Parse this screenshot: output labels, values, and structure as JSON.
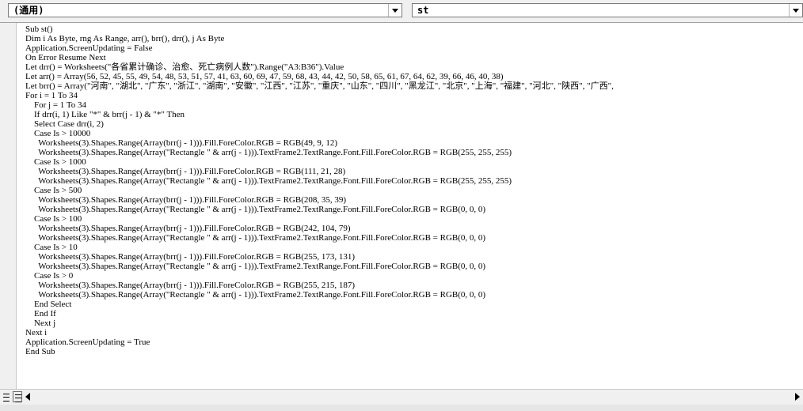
{
  "object_combo": {
    "value": "(通用)"
  },
  "procedure_combo": {
    "value": "st"
  },
  "code_lines": [
    "Sub st()",
    "Dim i As Byte, rng As Range, arr(), brr(), drr(), j As Byte",
    "Application.ScreenUpdating = False",
    "On Error Resume Next",
    "Let drr() = Worksheets(\"各省累计确诊、治愈、死亡病例人数\").Range(\"A3:B36\").Value",
    "Let arr() = Array(56, 52, 45, 55, 49, 54, 48, 53, 51, 57, 41, 63, 60, 69, 47, 59, 68, 43, 44, 42, 50, 58, 65, 61, 67, 64, 62, 39, 66, 46, 40, 38)",
    "Let brr() = Array(\"河南\", \"湖北\", \"广东\", \"浙江\", \"湖南\", \"安徽\", \"江西\", \"江苏\", \"重庆\", \"山东\", \"四川\", \"黑龙江\", \"北京\", \"上海\", \"福建\", \"河北\", \"陕西\", \"广西\",",
    "For i = 1 To 34",
    "    For j = 1 To 34",
    "    If drr(i, 1) Like \"*\" & brr(j - 1) & \"*\" Then",
    "    Select Case drr(i, 2)",
    "    Case Is > 10000",
    "      Worksheets(3).Shapes.Range(Array(brr(j - 1))).Fill.ForeColor.RGB = RGB(49, 9, 12)",
    "      Worksheets(3).Shapes.Range(Array(\"Rectangle \" & arr(j - 1))).TextFrame2.TextRange.Font.Fill.ForeColor.RGB = RGB(255, 255, 255)",
    "    Case Is > 1000",
    "      Worksheets(3).Shapes.Range(Array(brr(j - 1))).Fill.ForeColor.RGB = RGB(111, 21, 28)",
    "      Worksheets(3).Shapes.Range(Array(\"Rectangle \" & arr(j - 1))).TextFrame2.TextRange.Font.Fill.ForeColor.RGB = RGB(255, 255, 255)",
    "    Case Is > 500",
    "      Worksheets(3).Shapes.Range(Array(brr(j - 1))).Fill.ForeColor.RGB = RGB(208, 35, 39)",
    "      Worksheets(3).Shapes.Range(Array(\"Rectangle \" & arr(j - 1))).TextFrame2.TextRange.Font.Fill.ForeColor.RGB = RGB(0, 0, 0)",
    "    Case Is > 100",
    "      Worksheets(3).Shapes.Range(Array(brr(j - 1))).Fill.ForeColor.RGB = RGB(242, 104, 79)",
    "      Worksheets(3).Shapes.Range(Array(\"Rectangle \" & arr(j - 1))).TextFrame2.TextRange.Font.Fill.ForeColor.RGB = RGB(0, 0, 0)",
    "    Case Is > 10",
    "      Worksheets(3).Shapes.Range(Array(brr(j - 1))).Fill.ForeColor.RGB = RGB(255, 173, 131)",
    "      Worksheets(3).Shapes.Range(Array(\"Rectangle \" & arr(j - 1))).TextFrame2.TextRange.Font.Fill.ForeColor.RGB = RGB(0, 0, 0)",
    "    Case Is > 0",
    "      Worksheets(3).Shapes.Range(Array(brr(j - 1))).Fill.ForeColor.RGB = RGB(255, 215, 187)",
    "      Worksheets(3).Shapes.Range(Array(\"Rectangle \" & arr(j - 1))).TextFrame2.TextRange.Font.Fill.ForeColor.RGB = RGB(0, 0, 0)",
    "    End Select",
    "    End If",
    "    Next j",
    "Next i",
    "Application.ScreenUpdating = True",
    "End Sub"
  ],
  "icons": {
    "object_dropdown": "chevron-down-icon",
    "procedure_dropdown": "chevron-down-icon",
    "procedure_view": "procedure-view-icon",
    "full_module_view": "full-module-view-icon",
    "scroll_left": "arrow-left-icon",
    "scroll_right": "arrow-right-icon"
  }
}
